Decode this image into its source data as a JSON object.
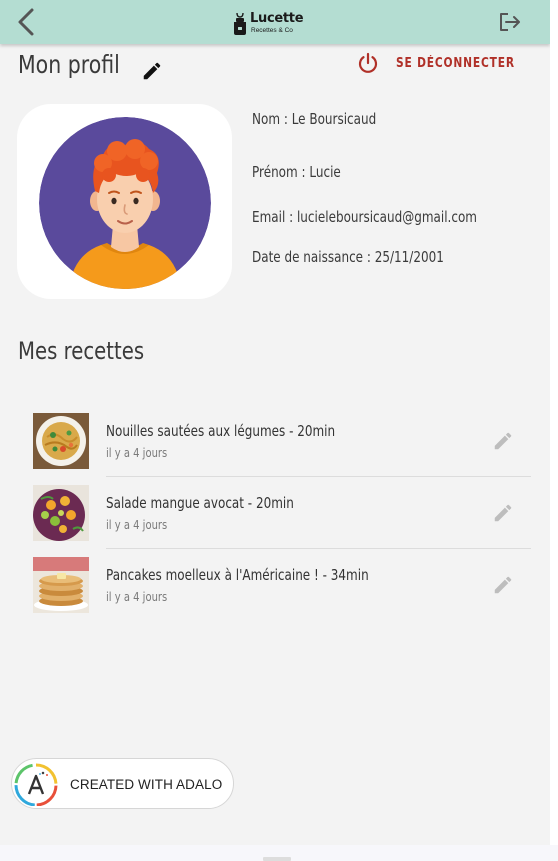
{
  "app": {
    "logo_title": "Lucette",
    "logo_subtitle": "Recettes & Co"
  },
  "profile": {
    "title": "Mon profil",
    "logout_label": "SE DÉCONNECTER",
    "fields": [
      {
        "key": "Nom : ",
        "value": "Le Boursicaud"
      },
      {
        "key": "Prénom : ",
        "value": "Lucie"
      },
      {
        "key": "Email : ",
        "value": "lucieleboursicaud@gmail.com"
      },
      {
        "key": "Date de naissance : ",
        "value": "25/11/2001"
      }
    ]
  },
  "recipes": {
    "title": "Mes recettes",
    "items": [
      {
        "title": "Nouilles sautées aux légumes - 20min",
        "subtitle": "il y a 4 jours"
      },
      {
        "title": "Salade mangue avocat - 20min",
        "subtitle": "il y a 4 jours"
      },
      {
        "title": "Pancakes moelleux à l'Américaine ! - 34min",
        "subtitle": "il y a 4 jours"
      }
    ]
  },
  "badge": {
    "label": "CREATED WITH ADALO"
  },
  "colors": {
    "topbar": "#b4ddd2",
    "logout_red": "#b03028",
    "avatar_bg": "#5a4a9c",
    "background": "#f3f3f3"
  },
  "icons": {
    "back": "chevron-left-icon",
    "logout": "logout-icon",
    "edit": "pencil-icon",
    "power": "power-icon"
  }
}
